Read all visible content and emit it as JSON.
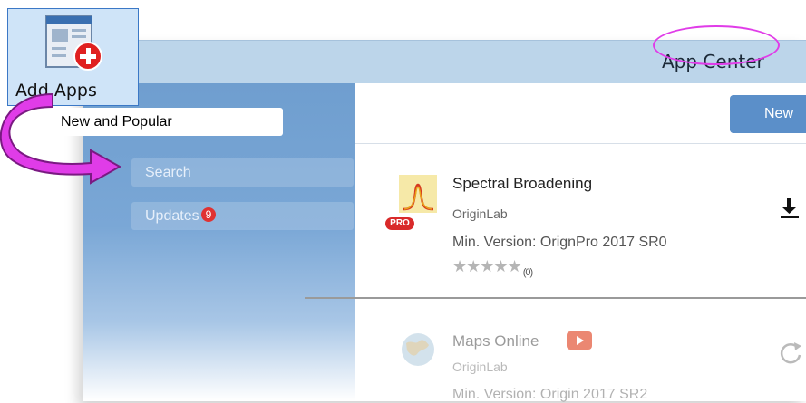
{
  "window": {
    "title": "App Center"
  },
  "toolbar": {
    "add_apps_label": "Add Apps",
    "new_button_label": "New"
  },
  "sidebar": {
    "items": [
      {
        "label": "New and Popular",
        "active": true
      },
      {
        "label": "Search",
        "active": false
      },
      {
        "label": "Updates",
        "active": false,
        "badge": "9"
      }
    ]
  },
  "apps": [
    {
      "name": "Spectral Broadening",
      "vendor": "OriginLab",
      "version": "Min. Version: OrignPro 2017 SR0",
      "rating_count": "(0)",
      "pro_badge": "PRO",
      "action_icon": "download-icon"
    },
    {
      "name": "Maps Online",
      "vendor": "OriginLab",
      "version": "Min. Version: Origin 2017 SR2",
      "action_icon": "refresh-icon"
    }
  ],
  "colors": {
    "highlight_ring": "#e03ce8",
    "arrow": "#e03ce8",
    "accent": "#5b8fc9",
    "badge": "#e03232"
  }
}
